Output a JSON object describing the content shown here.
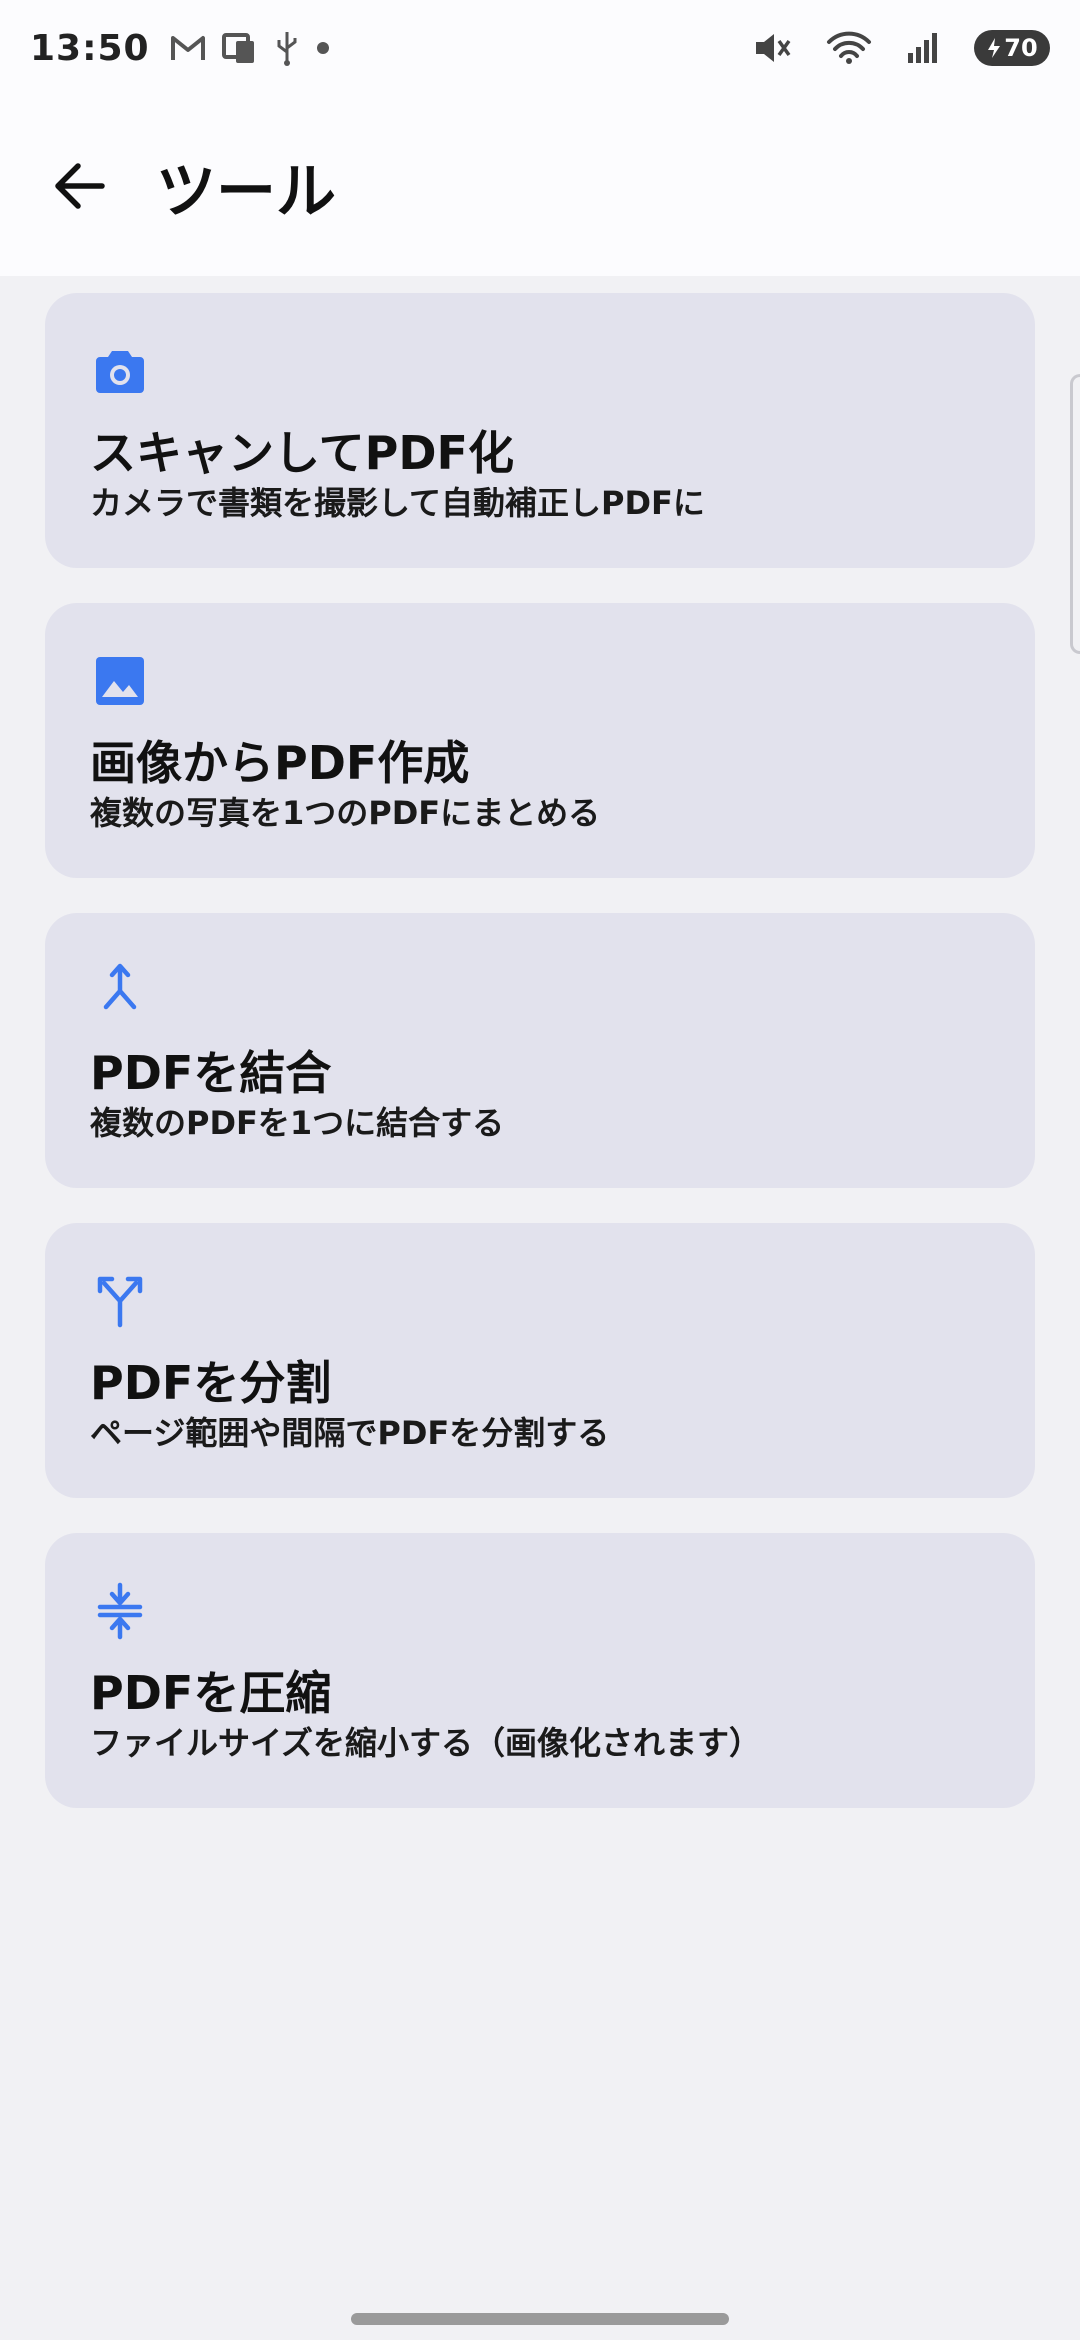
{
  "status_bar": {
    "time": "13:50",
    "battery_level": "70",
    "icons": [
      "gmail-icon",
      "notification-icon",
      "usb-icon",
      "dot-icon",
      "mute-icon",
      "wifi-icon",
      "signal-icon",
      "battery-charging-icon"
    ]
  },
  "app_bar": {
    "back_icon": "arrow-back-icon",
    "title": "ツール"
  },
  "colors": {
    "accent": "#3b78f0",
    "card_bg": "#e2e2ed",
    "page_bg": "#f1f1f4"
  },
  "tools": [
    {
      "icon": "camera-icon",
      "title": "スキャンしてPDF化",
      "subtitle": "カメラで書類を撮影して自動補正しPDFに"
    },
    {
      "icon": "image-icon",
      "title": "画像からPDF作成",
      "subtitle": "複数の写真を1つのPDFにまとめる"
    },
    {
      "icon": "merge-icon",
      "title": "PDFを結合",
      "subtitle": "複数のPDFを1つに結合する"
    },
    {
      "icon": "split-icon",
      "title": "PDFを分割",
      "subtitle": "ページ範囲や間隔でPDFを分割する"
    },
    {
      "icon": "compress-icon",
      "title": "PDFを圧縮",
      "subtitle": "ファイルサイズを縮小する（画像化されます）"
    }
  ]
}
